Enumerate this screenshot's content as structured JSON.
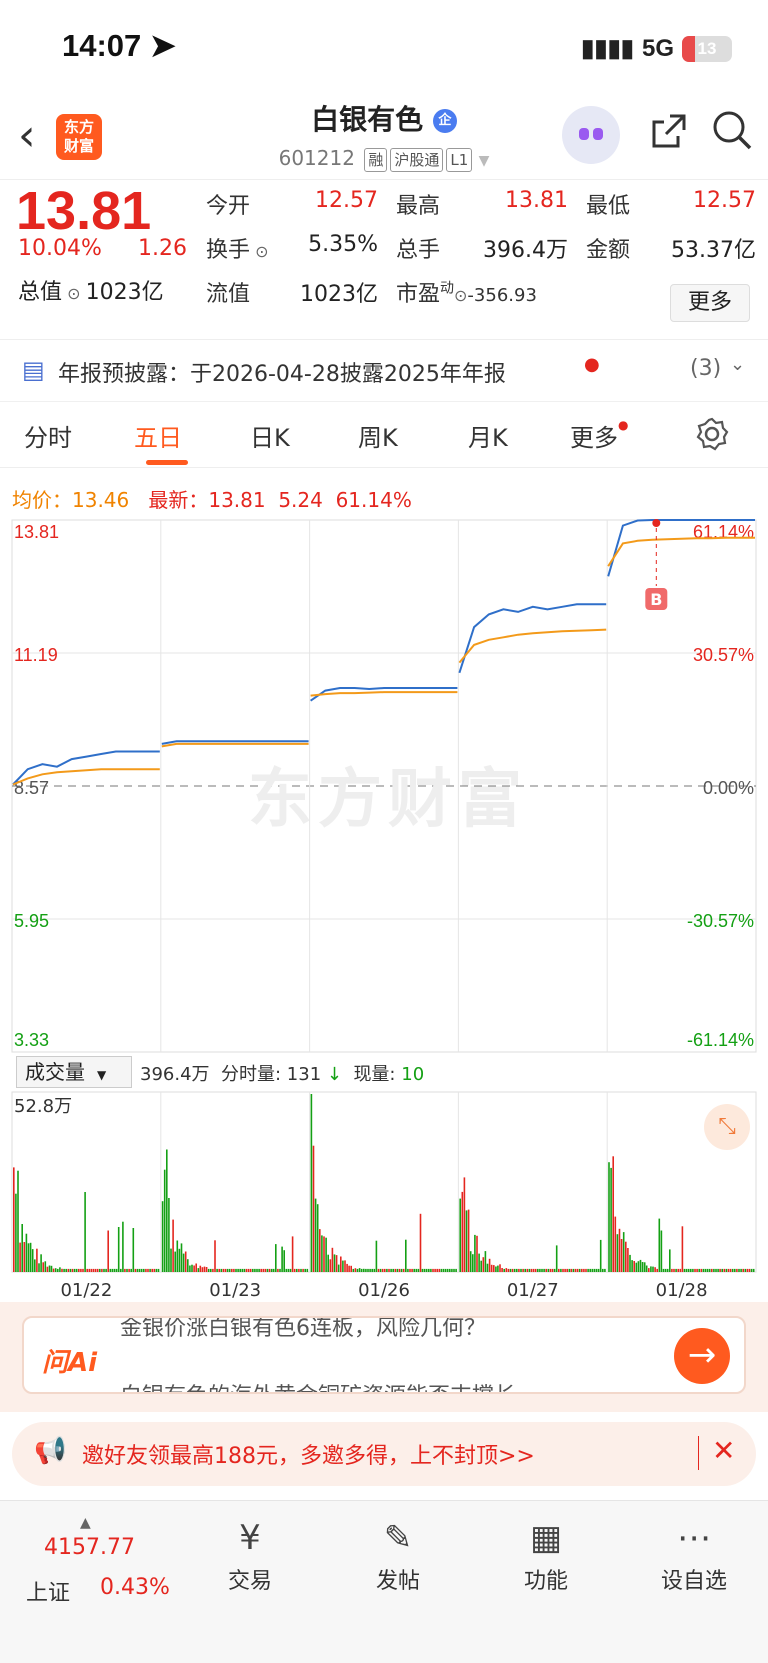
{
  "status_bar": {
    "time": "14:07",
    "network": "5G",
    "battery": "13"
  },
  "header": {
    "logo_line1": "东方",
    "logo_line2": "财富",
    "stock_name": "白银有色",
    "stock_code": "601212",
    "tags": [
      "融",
      "沪股通",
      "L1"
    ],
    "badge": "企"
  },
  "quote": {
    "price": "13.81",
    "change_pct": "10.04%",
    "change": "1.26",
    "open_label": "今开",
    "open": "12.57",
    "high_label": "最高",
    "high": "13.81",
    "low_label": "最低",
    "low": "12.57",
    "turnover_label": "换手",
    "turnover": "5.35%",
    "volume_label": "总手",
    "volume": "396.4万",
    "amount_label": "金额",
    "amount": "53.37亿",
    "mktcap_label": "总值",
    "mktcap": "1023亿",
    "float_label": "流值",
    "float_cap": "1023亿",
    "pe_label": "市盈",
    "pe_sup": "动",
    "pe": "-356.93",
    "more": "更多"
  },
  "notice": {
    "text": "年报预披露：于2026-04-28披露2025年年报",
    "count": "(3)"
  },
  "tabs": [
    "分时",
    "五日",
    "日K",
    "周K",
    "月K",
    "更多"
  ],
  "active_tab": "五日",
  "avg_bar": {
    "avg_label": "均价：",
    "avg": "13.46",
    "latest_label": "最新：",
    "latest": "13.81",
    "chg": "5.24",
    "pct": "61.14%"
  },
  "watermark": "东方财富",
  "chart_data": [
    {
      "type": "line",
      "title": "",
      "x": [
        "01/22",
        "01/23",
        "01/26",
        "01/27",
        "01/28"
      ],
      "y_ticks_left": [
        "13.81",
        "11.19",
        "8.57",
        "5.95",
        "3.33"
      ],
      "y_ticks_right": [
        "61.14%",
        "30.57%",
        "0.00%",
        "-30.57%",
        "-61.14%"
      ],
      "ylim": [
        3.33,
        13.81
      ],
      "series": [
        {
          "name": "",
          "color": "#2f6fc9",
          "day_values": [
            [
              8.6,
              8.9,
              9.0,
              8.95,
              9.1,
              9.15,
              9.2,
              9.25,
              9.25,
              9.25,
              9.25
            ],
            [
              9.4,
              9.45,
              9.45,
              9.45,
              9.45,
              9.45,
              9.45,
              9.45,
              9.45,
              9.45,
              9.45
            ],
            [
              10.25,
              10.45,
              10.5,
              10.5,
              10.48,
              10.5,
              10.5,
              10.5,
              10.5,
              10.5,
              10.5
            ],
            [
              10.8,
              11.7,
              11.95,
              12.05,
              12.0,
              12.1,
              12.05,
              12.1,
              12.15,
              12.15,
              12.15
            ],
            [
              12.7,
              13.7,
              13.8,
              13.81,
              13.81,
              13.81,
              13.81,
              13.81,
              13.81,
              13.81,
              13.81
            ]
          ]
        },
        {
          "name": "",
          "color": "#f39a1a",
          "day_values": [
            [
              8.6,
              8.72,
              8.8,
              8.84,
              8.86,
              8.88,
              8.9,
              8.9,
              8.9,
              8.9,
              8.9
            ],
            [
              9.35,
              9.4,
              9.4,
              9.4,
              9.4,
              9.4,
              9.4,
              9.4,
              9.4,
              9.4,
              9.4
            ],
            [
              10.35,
              10.38,
              10.4,
              10.4,
              10.41,
              10.42,
              10.42,
              10.42,
              10.42,
              10.42,
              10.42
            ],
            [
              11.0,
              11.35,
              11.45,
              11.5,
              11.55,
              11.58,
              11.6,
              11.62,
              11.63,
              11.64,
              11.65
            ],
            [
              12.9,
              13.35,
              13.4,
              13.42,
              13.43,
              13.44,
              13.45,
              13.45,
              13.46,
              13.46,
              13.46
            ]
          ]
        }
      ],
      "marker": "B"
    },
    {
      "type": "bar",
      "title": "",
      "categories": [
        "01/22",
        "01/23",
        "01/26",
        "01/27",
        "01/28"
      ],
      "max_label": "52.8万",
      "ylim": [
        0,
        52.8
      ]
    }
  ],
  "volume_panel": {
    "selector": "成交量",
    "total": "396.4万",
    "tick_label": "分时量:",
    "tick_val": "131",
    "cur_label": "现量:",
    "cur_val": "10"
  },
  "ai": {
    "logo": "问Ai",
    "line1": "金银价涨白银有色6连板，风险几何？",
    "line2": "白银有色的海外黄金铜矿资源能否支撑长"
  },
  "promo": {
    "text": "邀好友领最高188元，多邀多得，上不封顶>>"
  },
  "bottom_nav": {
    "index_value": "4157.77",
    "index_name": "上证",
    "index_change": "0.43%",
    "items": [
      "交易",
      "发帖",
      "功能",
      "设自选"
    ]
  }
}
